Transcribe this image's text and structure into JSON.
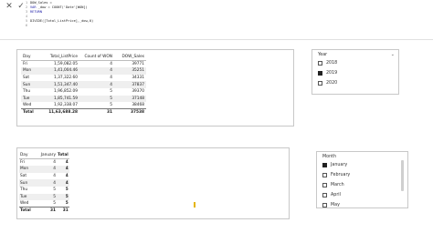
{
  "formula_bar": {
    "cancel_icon": "x-icon",
    "commit_icon": "check-icon",
    "lines": [
      {
        "n": "1",
        "parts": [
          {
            "t": "DOW_Sales = ",
            "k": "txt"
          }
        ]
      },
      {
        "n": "2",
        "parts": [
          {
            "t": "VAR ",
            "k": "kw"
          },
          {
            "t": "_dow = COUNT('Date'[WON])",
            "k": "txt"
          }
        ]
      },
      {
        "n": "3",
        "parts": [
          {
            "t": "RETURN",
            "k": "kw"
          }
        ]
      },
      {
        "n": "4",
        "parts": []
      },
      {
        "n": "5",
        "parts": [
          {
            "t": "DIVIDE([Total_ListPrice],_dow,0)",
            "k": "txt"
          }
        ]
      },
      {
        "n": "6",
        "parts": []
      }
    ]
  },
  "table1": {
    "headers": [
      "Day",
      "Total_ListPrice",
      "Count of WON",
      "DOW_Sales"
    ],
    "rows": [
      [
        "Fri",
        "1,59,082.05",
        "4",
        "39771"
      ],
      [
        "Mon",
        "1,41,004.46",
        "4",
        "35251"
      ],
      [
        "Sat",
        "1,37,322.60",
        "4",
        "34331"
      ],
      [
        "Sun",
        "1,51,347.40",
        "4",
        "37837"
      ],
      [
        "Thu",
        "1,96,852.09",
        "5",
        "39370"
      ],
      [
        "Tue",
        "1,85,741.59",
        "5",
        "37148"
      ],
      [
        "Wed",
        "1,92,338.07",
        "5",
        "38468"
      ]
    ],
    "total": [
      "Total",
      "11,63,688.28",
      "31",
      "37538"
    ]
  },
  "year_slicer": {
    "title": "Year",
    "items": [
      {
        "label": "2018",
        "checked": false
      },
      {
        "label": "2019",
        "checked": true
      },
      {
        "label": "2020",
        "checked": false
      }
    ]
  },
  "table2": {
    "headers": [
      "Day",
      "January",
      "Total"
    ],
    "rows": [
      [
        "Fri",
        "4",
        "4"
      ],
      [
        "Mon",
        "4",
        "4"
      ],
      [
        "Sat",
        "4",
        "4"
      ],
      [
        "Sun",
        "4",
        "4"
      ],
      [
        "Thu",
        "5",
        "5"
      ],
      [
        "Tue",
        "5",
        "5"
      ],
      [
        "Wed",
        "5",
        "5"
      ]
    ],
    "total": [
      "Total",
      "31",
      "31"
    ]
  },
  "month_slicer": {
    "title": "Month",
    "items": [
      {
        "label": "January",
        "checked": true
      },
      {
        "label": "February",
        "checked": false
      },
      {
        "label": "March",
        "checked": false
      },
      {
        "label": "April",
        "checked": false
      },
      {
        "label": "May",
        "checked": false
      }
    ]
  }
}
